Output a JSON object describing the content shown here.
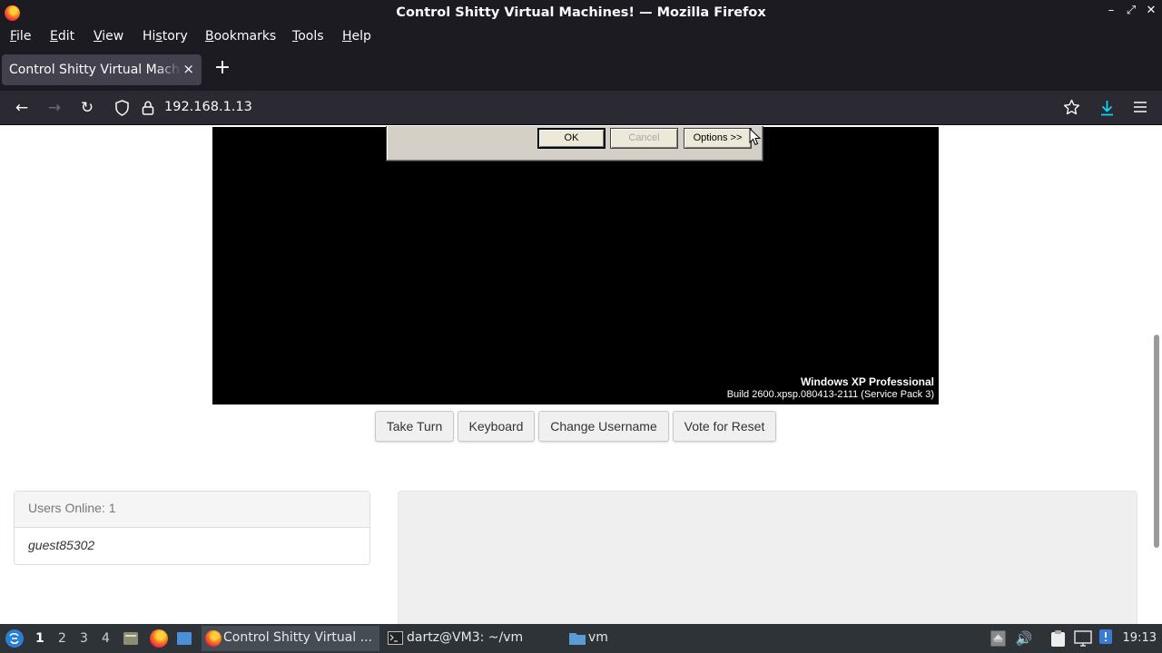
{
  "window": {
    "title": "Control Shitty Virtual Machines! — Mozilla Firefox",
    "controls": {
      "minimize": "–",
      "maximize": "⤢",
      "close": "✕"
    }
  },
  "menu": {
    "items": [
      {
        "pre": "",
        "u": "F",
        "post": "ile"
      },
      {
        "pre": "",
        "u": "E",
        "post": "dit"
      },
      {
        "pre": "",
        "u": "V",
        "post": "iew"
      },
      {
        "pre": "Hi",
        "u": "s",
        "post": "tory"
      },
      {
        "pre": "",
        "u": "B",
        "post": "ookmarks"
      },
      {
        "pre": "",
        "u": "T",
        "post": "ools"
      },
      {
        "pre": "",
        "u": "H",
        "post": "elp"
      }
    ]
  },
  "tabs": [
    {
      "label": "Control Shitty Virtual Machines!",
      "close": "×"
    }
  ],
  "newtab": "+",
  "nav": {
    "url": "192.168.1.13",
    "back": "←",
    "forward": "→",
    "reload": "↻"
  },
  "vm": {
    "dialog": {
      "ok": "OK",
      "cancel": "Cancel",
      "options": "Options >>"
    },
    "os_name": "Windows XP Professional",
    "os_build": "Build 2600.xpsp.080413-2111 (Service Pack 3)"
  },
  "vm_buttons": {
    "take_turn": "Take Turn",
    "keyboard": "Keyboard",
    "change_username": "Change Username",
    "vote_reset": "Vote for Reset"
  },
  "users": {
    "header": "Users Online: 1",
    "list": [
      "guest85302"
    ]
  },
  "taskbar": {
    "workspaces": [
      "1",
      "2",
      "3",
      "4"
    ],
    "active_workspace": "1",
    "tasks": [
      {
        "label": "Control Shitty Virtual ...",
        "icon": "firefox-icon",
        "active": true
      },
      {
        "label": "dartz@VM3: ~/vm",
        "icon": "terminal-icon",
        "active": false
      },
      {
        "label": "vm",
        "icon": "folder-icon",
        "active": false
      }
    ],
    "clock": "19:13"
  },
  "colors": {
    "chrome_dark": "#1c1b22",
    "toolbar": "#2b2a33",
    "download_accent": "#00ddff",
    "taskbar": "#2e3338"
  }
}
